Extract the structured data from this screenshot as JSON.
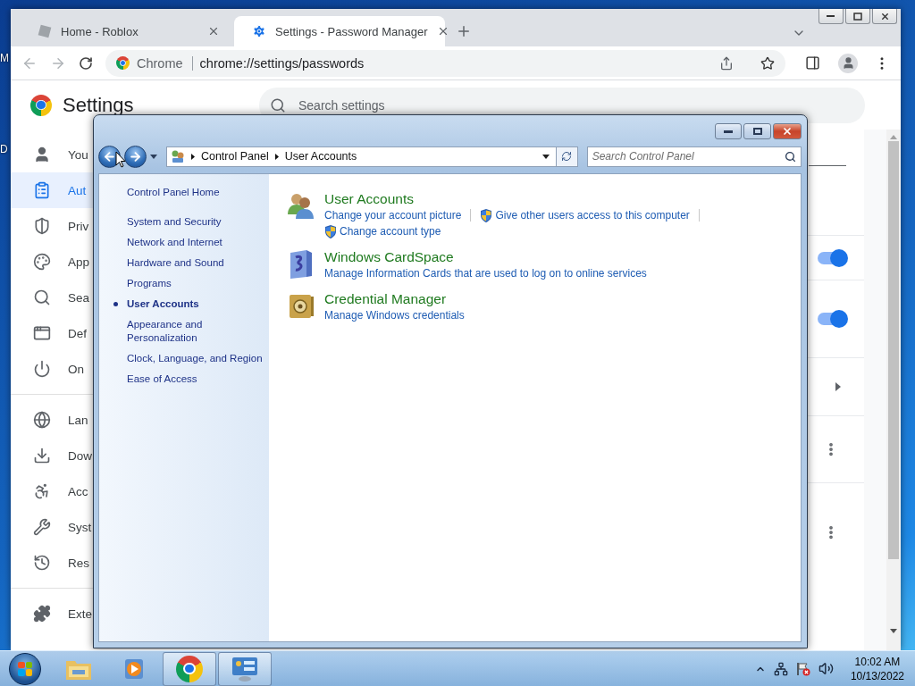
{
  "desktop": {
    "icon_labels": [
      "M",
      "D"
    ]
  },
  "browser": {
    "tabs": [
      {
        "title": "Home - Roblox",
        "selected": false
      },
      {
        "title": "Settings - Password Manager",
        "selected": true
      }
    ],
    "address": {
      "chip": "Chrome",
      "url": "chrome://settings/passwords"
    },
    "settings": {
      "title": "Settings",
      "search_placeholder": "Search settings",
      "nav_groups": [
        {
          "items": [
            {
              "label": "You",
              "selected": false
            },
            {
              "label": "Aut",
              "selected": true
            },
            {
              "label": "Priv",
              "selected": false
            },
            {
              "label": "App",
              "selected": false
            },
            {
              "label": "Sea",
              "selected": false
            },
            {
              "label": "Def",
              "selected": false
            },
            {
              "label": "On",
              "selected": false
            }
          ]
        },
        {
          "items": [
            {
              "label": "Lan",
              "selected": false
            },
            {
              "label": "Dow",
              "selected": false
            },
            {
              "label": "Acc",
              "selected": false
            },
            {
              "label": "Syst",
              "selected": false
            },
            {
              "label": "Res",
              "selected": false
            }
          ]
        },
        {
          "items": [
            {
              "label": "Exte",
              "selected": false
            }
          ]
        }
      ],
      "rows": [
        {
          "kind": "toggle",
          "on": true
        },
        {
          "kind": "toggle",
          "on": true
        },
        {
          "kind": "arrow"
        },
        {
          "kind": "menu"
        },
        {
          "kind": "menu"
        }
      ]
    }
  },
  "control_panel": {
    "breadcrumb": [
      "Control Panel",
      "User Accounts"
    ],
    "search_placeholder": "Search Control Panel",
    "sidebar": [
      {
        "label": "Control Panel Home",
        "selected": false
      },
      {
        "label": "System and Security",
        "selected": false
      },
      {
        "label": "Network and Internet",
        "selected": false
      },
      {
        "label": "Hardware and Sound",
        "selected": false
      },
      {
        "label": "Programs",
        "selected": false
      },
      {
        "label": "User Accounts",
        "selected": true
      },
      {
        "label": "Appearance and Personalization",
        "selected": false
      },
      {
        "label": "Clock, Language, and Region",
        "selected": false
      },
      {
        "label": "Ease of Access",
        "selected": false
      }
    ],
    "categories": [
      {
        "title": "User Accounts",
        "links": [
          {
            "text": "Change your account picture",
            "shield": false
          },
          {
            "text": "Give other users access to this computer",
            "shield": true
          },
          {
            "text": "Change account type",
            "shield": true
          }
        ]
      },
      {
        "title": "Windows CardSpace",
        "links": [
          {
            "text": "Manage Information Cards that are used to log on to online services",
            "shield": false
          }
        ]
      },
      {
        "title": "Credential Manager",
        "links": [
          {
            "text": "Manage Windows credentials",
            "shield": false
          }
        ]
      }
    ]
  },
  "taskbar": {
    "apps": [
      {
        "kind": "explorer",
        "active": false
      },
      {
        "kind": "media",
        "active": false
      },
      {
        "kind": "chrome",
        "active": true
      },
      {
        "kind": "control_panel",
        "active": true
      }
    ],
    "clock": {
      "time": "10:02 AM",
      "date": "10/13/2022"
    }
  }
}
